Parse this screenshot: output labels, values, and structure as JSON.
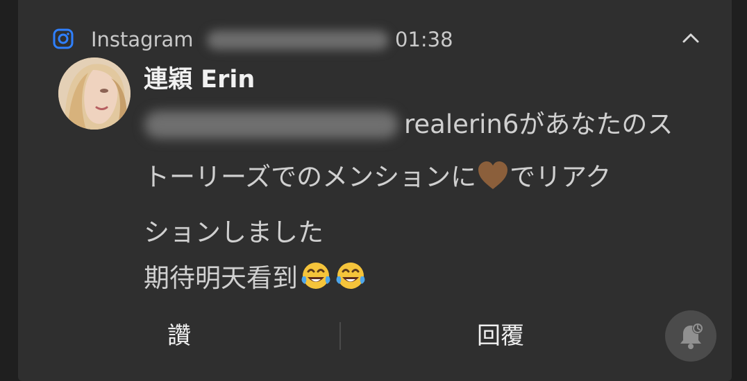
{
  "notification": {
    "app_name": "Instagram",
    "time": "01:38",
    "title": "連穎 Erin",
    "body_lines": [
      "realerin6があなたのス",
      "トーリーズでのメンションに",
      "でリアク",
      "ションしました",
      "期待明天看到"
    ],
    "icons": {
      "app": "instagram-icon",
      "collapse": "chevron-up-icon",
      "heart": "brown-heart-emoji",
      "emoji": "face-with-tears-of-joy-emoji",
      "snooze": "bell-snooze-icon"
    },
    "actions": {
      "like": "讚",
      "reply": "回覆"
    },
    "colors": {
      "card": "#2f2f2f",
      "accent": "#2f80ff",
      "text": "#d0d0d0"
    }
  }
}
